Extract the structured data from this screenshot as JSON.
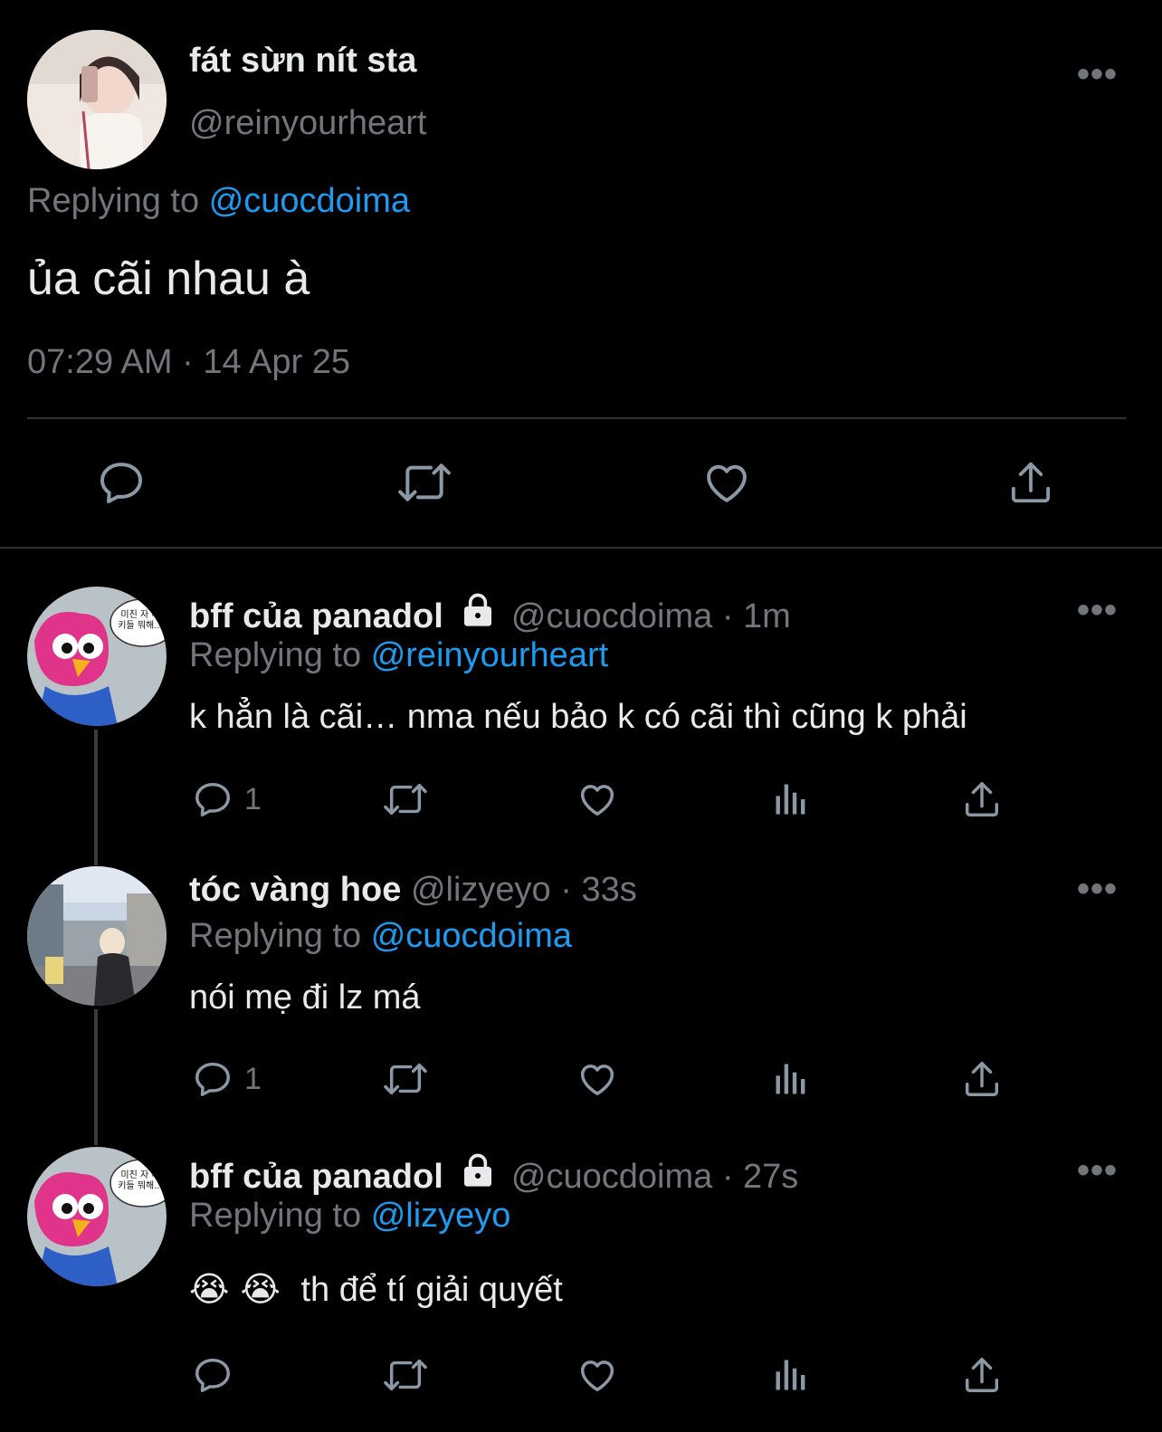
{
  "main_tweet": {
    "display_name": "fát sừn nít sta",
    "handle": "@reinyourheart",
    "replying_label": "Replying to",
    "replying_to": "@cuocdoima",
    "text": "ủa cãi nhau à",
    "timestamp": "07:29 AM · 14 Apr 25"
  },
  "replies": [
    {
      "display_name": "bff của panadol",
      "handle": "@cuocdoima",
      "time": "· 1m",
      "replying_label": "Replying to",
      "replying_to": "@reinyourheart",
      "text": "k hẳn là cãi… nma nếu bảo k có cãi thì cũng k phải",
      "reply_count": "1",
      "avatar_text": "미친 자 새키들 뭐해..."
    },
    {
      "display_name": "tóc vàng hoe",
      "handle": "@lizyeyo",
      "time": "· 33s",
      "replying_label": "Replying to",
      "replying_to": "@cuocdoima",
      "text": "nói mẹ đi lz má",
      "reply_count": "1"
    },
    {
      "display_name": "bff của panadol",
      "handle": "@cuocdoima",
      "time": "· 27s",
      "replying_label": "Replying to",
      "replying_to": "@lizyeyo",
      "emoji": "😭 😭",
      "text": "th để tí giải quyết",
      "reply_count": "",
      "avatar_text": "미친 자 새키들 뭐해..."
    }
  ],
  "more_label": "•••",
  "colors": {
    "background": "#000000",
    "accent": "#1d9bf0",
    "muted": "#71767b",
    "text": "#e7e9ea"
  },
  "icons": [
    "reply-icon",
    "retweet-icon",
    "like-icon",
    "views-icon",
    "share-icon",
    "more-icon",
    "lock-icon"
  ]
}
